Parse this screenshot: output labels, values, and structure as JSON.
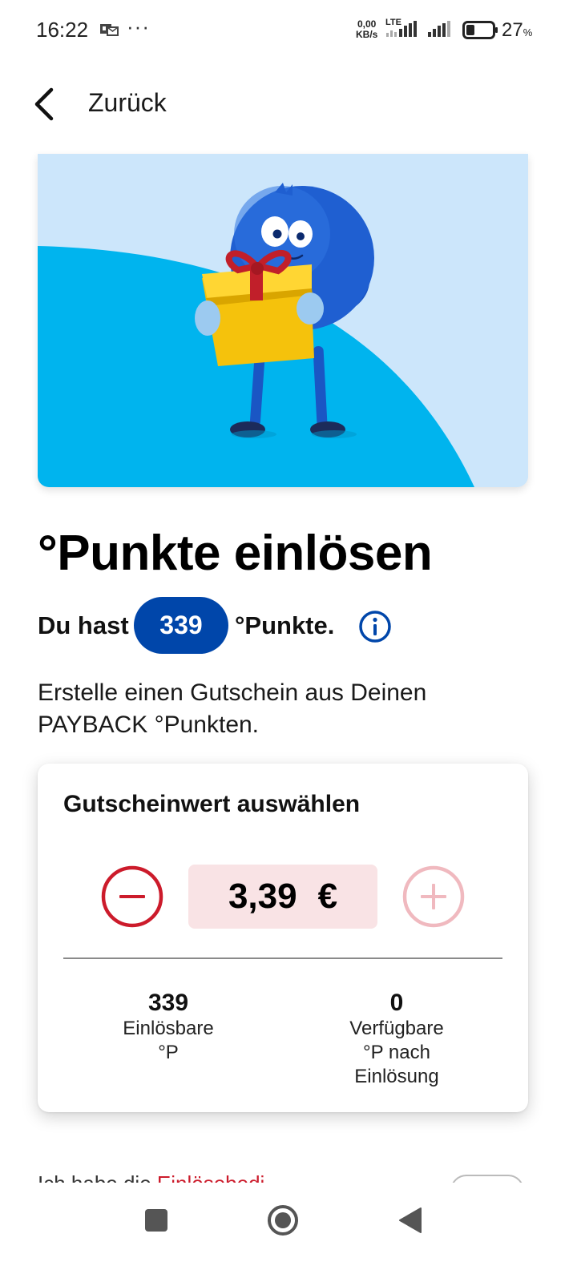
{
  "status_bar": {
    "time": "16:22",
    "net_speed_value": "0,00",
    "net_speed_unit": "KB/s",
    "network": "LTE",
    "battery_value": "27",
    "battery_unit": "%",
    "icons": [
      "notification-icon",
      "more-dots-icon",
      "signal-icon",
      "battery-icon"
    ]
  },
  "header": {
    "back_label": "Zurück"
  },
  "title": "°Punkte einlösen",
  "points": {
    "prefix": "Du hast",
    "value": "339",
    "suffix": "°Punkte."
  },
  "description": "Erstelle einen Gutschein aus Deinen PAYBACK °Punkten.",
  "voucher_card": {
    "title": "Gutscheinwert auswählen",
    "amount": "3,39",
    "currency": "€",
    "redeemable_value": "339",
    "redeemable_label": "Einlösbare °P",
    "remaining_value": "0",
    "remaining_label": "Verfügbare °P nach Einlösung"
  },
  "peek": {
    "text_prefix": "Ich habe die ",
    "text_link": "Einlösebedi"
  },
  "colors": {
    "primary_blue": "#0046aa",
    "red": "#cc1b2b",
    "amount_bg": "#f9e3e5"
  }
}
